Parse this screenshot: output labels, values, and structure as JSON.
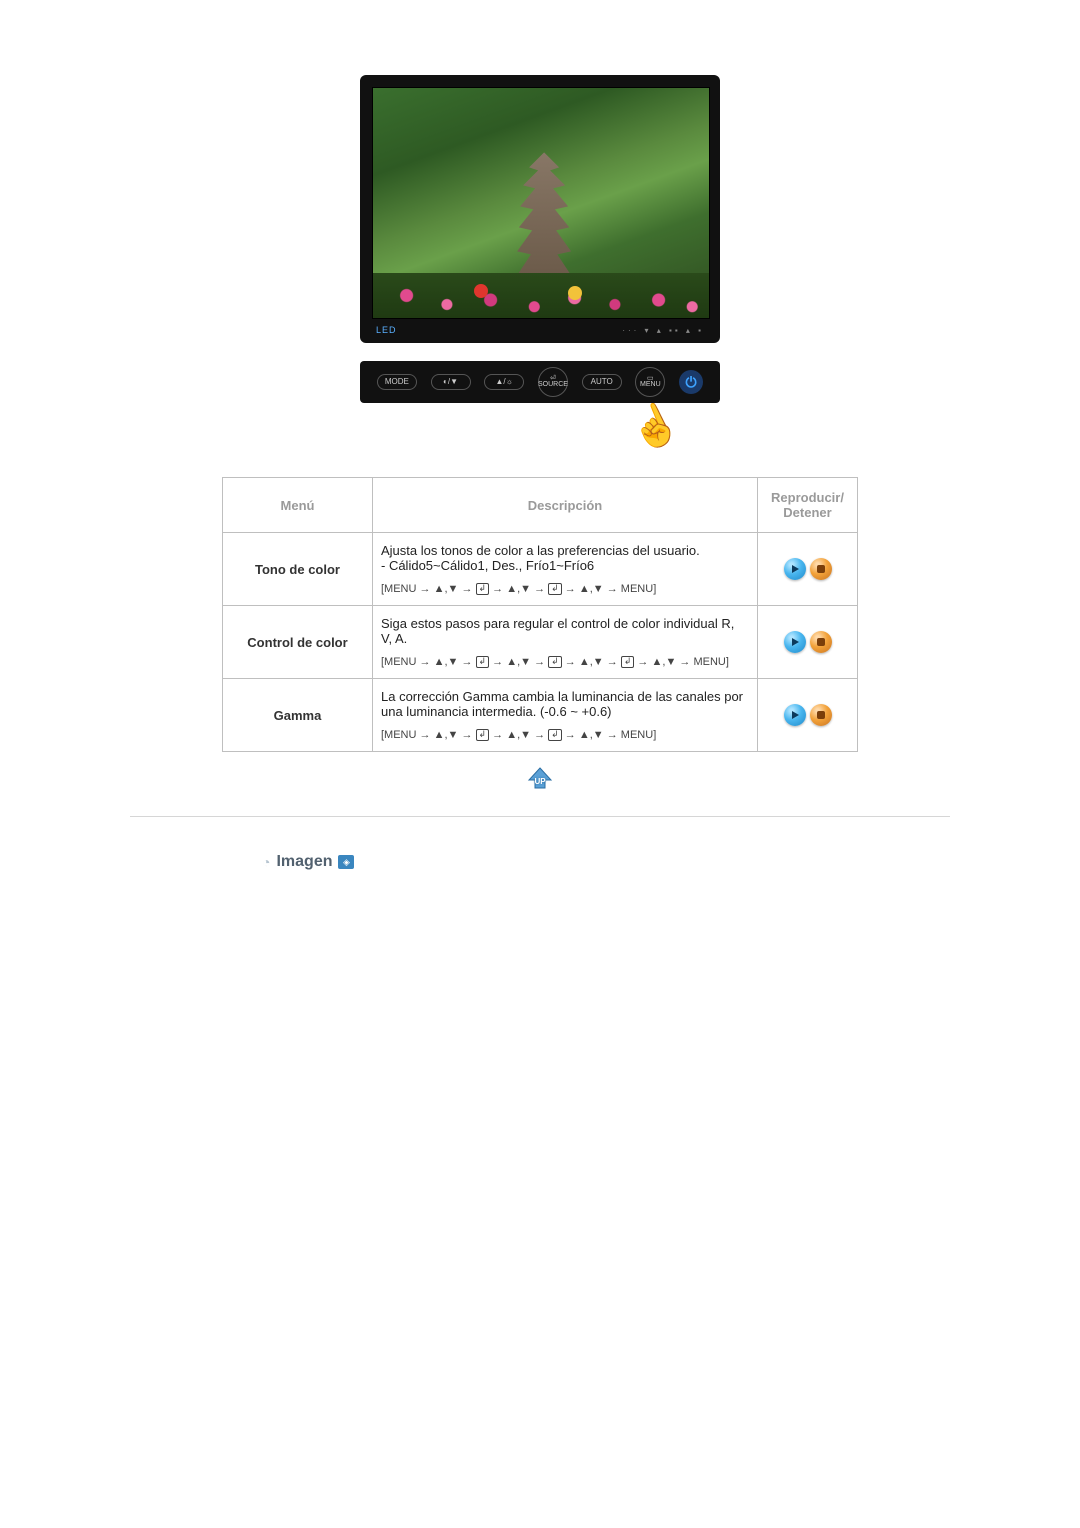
{
  "monitor": {
    "led_label": "LED",
    "ticks": "···  ▾  ▴  ▪▪  ▴  ▪",
    "buttons": {
      "mode": "MODE",
      "contrast": "◐/▼",
      "bright": "▲/☼",
      "source_top": "⏎",
      "source": "SOURCE",
      "auto": "AUTO",
      "menu_top": "▭",
      "menu": "MENU",
      "power": "⏻"
    }
  },
  "table": {
    "headers": {
      "menu": "Menú",
      "desc": "Descripción",
      "action": "Reproducir/ Detener"
    },
    "rows": [
      {
        "menu": "Tono de color",
        "desc": "Ajusta los tonos de color a las preferencias del usuario.\n- Cálido5~Cálido1, Des., Frío1~Frío6",
        "seq_segments": [
          "[MENU → ",
          "▲",
          ",",
          "▼",
          " → ",
          "ENTER",
          " → ",
          "▲",
          ",",
          "▼",
          " → ",
          "ENTER",
          " → ",
          "▲",
          ",",
          "▼",
          " → MENU]"
        ]
      },
      {
        "menu": "Control de color",
        "desc": "Siga estos pasos para regular el control de color individual R, V, A.",
        "seq_segments": [
          "[MENU → ",
          "▲",
          ",",
          "▼",
          " → ",
          "ENTER",
          " → ",
          "▲",
          ",",
          "▼",
          " → ",
          "ENTER",
          " → ",
          "▲",
          ",",
          "▼",
          " → ",
          "ENTER",
          " → ",
          "▲",
          ",",
          "▼",
          " → MENU]"
        ]
      },
      {
        "menu": "Gamma",
        "desc": "La corrección Gamma cambia la luminancia de las canales por una luminancia intermedia. (-0.6 ~ +0.6)",
        "seq_segments": [
          "[MENU → ",
          "▲",
          ",",
          "▼",
          " → ",
          "ENTER",
          " → ",
          "▲",
          ",",
          "▼",
          " → ",
          "ENTER",
          " → ",
          "▲",
          ",",
          "▼",
          " → MENU]"
        ]
      }
    ]
  },
  "up_label": "UP",
  "section_imagen": "Imagen"
}
